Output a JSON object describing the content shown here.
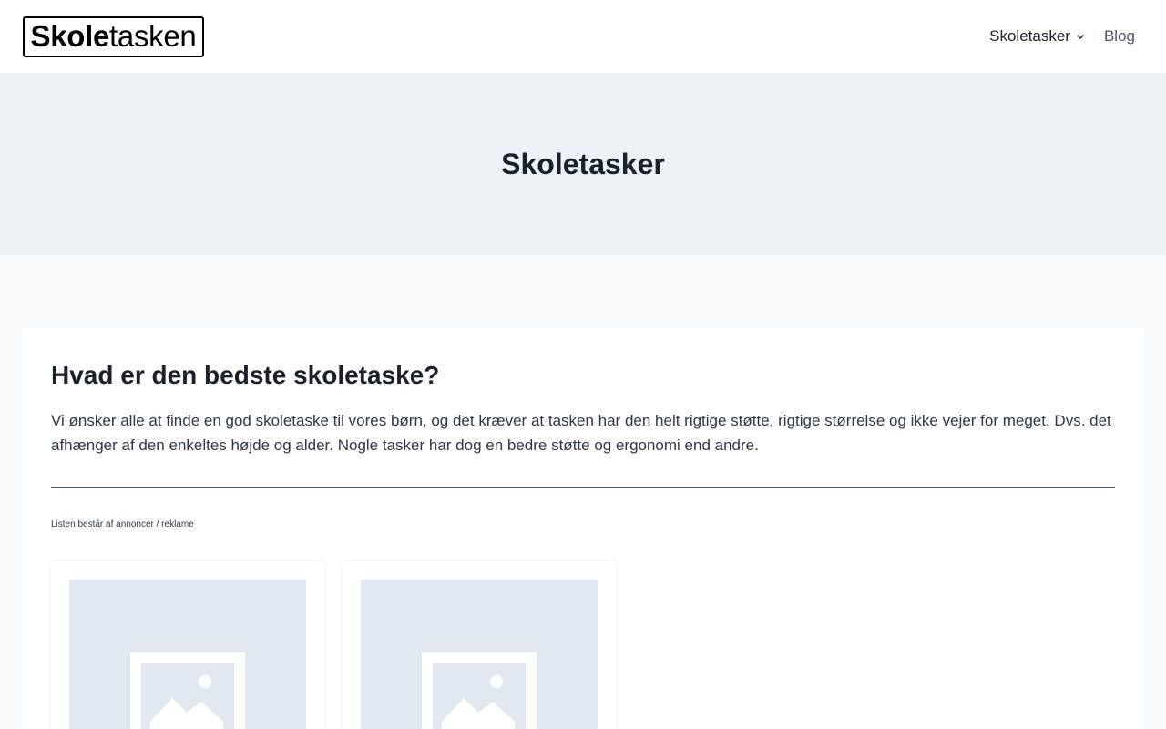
{
  "header": {
    "logo": {
      "bold": "Skole",
      "light": "tasken"
    },
    "nav": [
      {
        "label": "Skoletasker",
        "has_dropdown": true
      },
      {
        "label": "Blog",
        "has_dropdown": false
      }
    ]
  },
  "hero": {
    "title": "Skoletasker"
  },
  "main": {
    "heading": "Hvad er den bedste skoletaske?",
    "intro": "Vi ønsker alle at finde en god skoletaske til vores børn, og det kræver at tasken har den helt rigtige støtte, rigtige størrelse og ikke vejer for meget. Dvs. det afhænger af den enkeltes højde og alder. Nogle tasker har dog en bedre støtte og ergonomi end andre.",
    "disclaimer": "Listen består af annoncer / reklame",
    "cards": [
      {
        "image_icon": "image-placeholder-icon"
      },
      {
        "image_icon": "image-placeholder-icon"
      }
    ]
  },
  "colors": {
    "header_bg": "#ffffff",
    "hero_bg": "#edf2f7",
    "page_bg": "#f7fafc",
    "placeholder_bg": "#e2e8f0",
    "text": "#1a202c"
  }
}
